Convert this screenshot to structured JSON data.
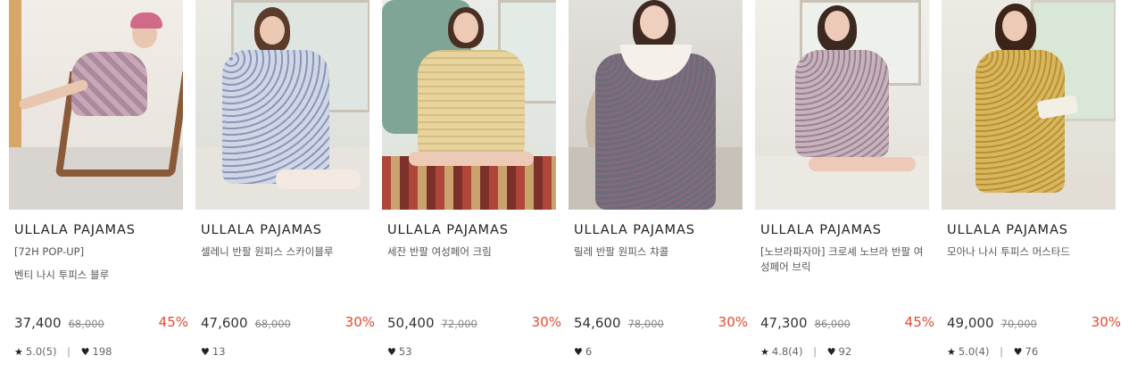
{
  "products": [
    {
      "brand": "ULLALA PAJAMAS",
      "name": "[72H POP-UP]",
      "name2": "벤티 나시 투피스 블루",
      "price": "37,400",
      "original_price": "68,000",
      "discount": "45%",
      "rating": "5.0(5)",
      "likes": "198"
    },
    {
      "brand": "ULLALA PAJAMAS",
      "name": "셀레니 반팔 원피스 스카이블루",
      "price": "47,600",
      "original_price": "68,000",
      "discount": "30%",
      "likes": "13"
    },
    {
      "brand": "ULLALA PAJAMAS",
      "name": "세잔 반팔 여성페어 크림",
      "price": "50,400",
      "original_price": "72,000",
      "discount": "30%",
      "likes": "53"
    },
    {
      "brand": "ULLALA PAJAMAS",
      "name": "릴레 반팔 원피스 챠콜",
      "price": "54,600",
      "original_price": "78,000",
      "discount": "30%",
      "likes": "6"
    },
    {
      "brand": "ULLALA PAJAMAS",
      "name": "[노브라파자마] 크로셰 노브라 반팔 여성페어 브릭",
      "price": "47,300",
      "original_price": "86,000",
      "discount": "45%",
      "rating": "4.8(4)",
      "likes": "92"
    },
    {
      "brand": "ULLALA PAJAMAS",
      "name": "모아나 나시 투피스 머스타드",
      "price": "49,000",
      "original_price": "70,000",
      "discount": "30%",
      "rating": "5.0(4)",
      "likes": "76"
    }
  ],
  "icons": {
    "star": "star-icon",
    "heart": "heart-icon"
  },
  "colors": {
    "discount": "#e8472d"
  }
}
